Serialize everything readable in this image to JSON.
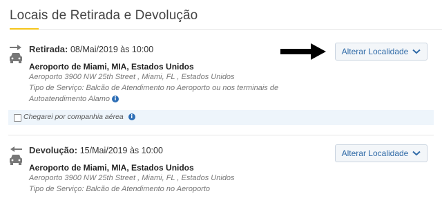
{
  "section_title": "Locais de Retirada e Devolução",
  "pickup": {
    "label": "Retirada:",
    "datetime": "08/Mai/2019 às 10:00",
    "location_name": "Aeroporto de Miami, MIA, Estados Unidos",
    "address": "Aeroporto 3900 NW 25th Street , Miami, FL , Estados Unidos",
    "service_line1": "Tipo de Serviço: Balcão de Atendimento no Aeroporto ou nos terminais de",
    "service_line2": "Autoatendimento Alamo",
    "change_button": "Alterar Localidade",
    "airline_checkbox_label": "Chegarei por companhia aérea",
    "airline_checkbox_checked": false
  },
  "dropoff": {
    "label": "Devolução:",
    "datetime": "15/Mai/2019 às 10:00",
    "location_name": "Aeroporto de Miami, MIA, Estados Unidos",
    "address": "Aeroporto 3900 NW 25th Street , Miami, FL , Estados Unidos",
    "service_line1": "Tipo de Serviço: Balcão de Atendimento no Aeroporto",
    "change_button": "Alterar Localidade"
  },
  "icons": {
    "pickup": "car-arrow-right-icon",
    "dropoff": "car-arrow-left-icon",
    "info": "info-icon",
    "chevron": "chevron-down-icon",
    "pointer": "black-arrow-icon"
  },
  "colors": {
    "accent_underline": "#f5c518",
    "link_blue": "#2f6aa7",
    "info_blue": "#2e6fb6",
    "airline_row_bg": "#eef5fb"
  }
}
